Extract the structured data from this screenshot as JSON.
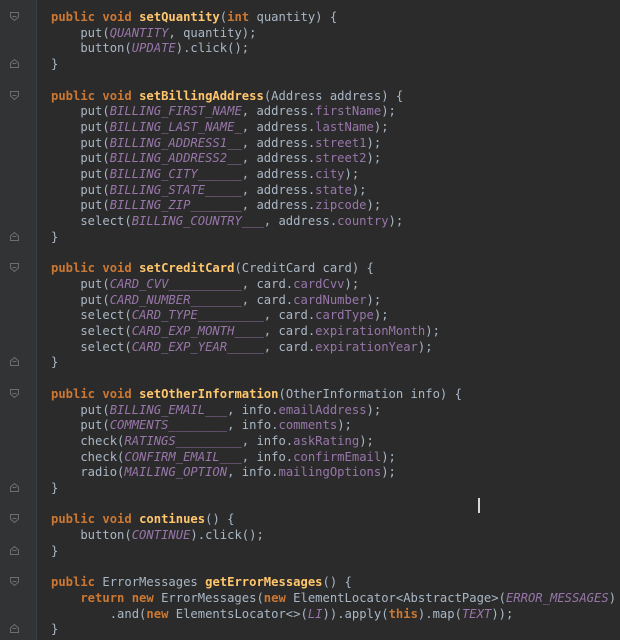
{
  "editor": {
    "theme": {
      "background": "#2b2b2b",
      "keyword": "#cc7832",
      "method": "#ffc66d",
      "constant": "#9876aa",
      "text": "#a9b7c6"
    },
    "lines": [
      {
        "fold": "start",
        "tokens": [
          [
            "kw",
            "public "
          ],
          [
            "kw",
            "void "
          ],
          [
            "fn",
            "setQuantity"
          ],
          [
            "pl",
            "("
          ],
          [
            "kw",
            "int "
          ],
          [
            "pl",
            "quantity) {"
          ]
        ]
      },
      {
        "fold": "",
        "tokens": [
          [
            "pl",
            "    put("
          ],
          [
            "cn",
            "QUANTITY"
          ],
          [
            "pl",
            ", quantity);"
          ]
        ]
      },
      {
        "fold": "",
        "tokens": [
          [
            "pl",
            "    button("
          ],
          [
            "cn",
            "UPDATE"
          ],
          [
            "pl",
            ").click();"
          ]
        ]
      },
      {
        "fold": "end",
        "tokens": [
          [
            "pl",
            "}"
          ]
        ]
      },
      {
        "fold": "",
        "tokens": []
      },
      {
        "fold": "start",
        "tokens": [
          [
            "kw",
            "public "
          ],
          [
            "kw",
            "void "
          ],
          [
            "fn",
            "setBillingAddress"
          ],
          [
            "pl",
            "(Address address) {"
          ]
        ]
      },
      {
        "fold": "",
        "tokens": [
          [
            "pl",
            "    put("
          ],
          [
            "cn",
            "BILLING_FIRST_NAME"
          ],
          [
            "pl",
            ", address."
          ],
          [
            "fd",
            "firstName"
          ],
          [
            "pl",
            ");"
          ]
        ]
      },
      {
        "fold": "",
        "tokens": [
          [
            "pl",
            "    put("
          ],
          [
            "cn",
            "BILLING_LAST_NAME_"
          ],
          [
            "pl",
            ", address."
          ],
          [
            "fd",
            "lastName"
          ],
          [
            "pl",
            ");"
          ]
        ]
      },
      {
        "fold": "",
        "tokens": [
          [
            "pl",
            "    put("
          ],
          [
            "cn",
            "BILLING_ADDRESS1__"
          ],
          [
            "pl",
            ", address."
          ],
          [
            "fd",
            "street1"
          ],
          [
            "pl",
            ");"
          ]
        ]
      },
      {
        "fold": "",
        "tokens": [
          [
            "pl",
            "    put("
          ],
          [
            "cn",
            "BILLING_ADDRESS2__"
          ],
          [
            "pl",
            ", address."
          ],
          [
            "fd",
            "street2"
          ],
          [
            "pl",
            ");"
          ]
        ]
      },
      {
        "fold": "",
        "tokens": [
          [
            "pl",
            "    put("
          ],
          [
            "cn",
            "BILLING_CITY______"
          ],
          [
            "pl",
            ", address."
          ],
          [
            "fd",
            "city"
          ],
          [
            "pl",
            ");"
          ]
        ]
      },
      {
        "fold": "",
        "tokens": [
          [
            "pl",
            "    put("
          ],
          [
            "cn",
            "BILLING_STATE_____"
          ],
          [
            "pl",
            ", address."
          ],
          [
            "fd",
            "state"
          ],
          [
            "pl",
            ");"
          ]
        ]
      },
      {
        "fold": "",
        "tokens": [
          [
            "pl",
            "    put("
          ],
          [
            "cn",
            "BILLING_ZIP_______"
          ],
          [
            "pl",
            ", address."
          ],
          [
            "fd",
            "zipcode"
          ],
          [
            "pl",
            ");"
          ]
        ]
      },
      {
        "fold": "",
        "tokens": [
          [
            "pl",
            "    select("
          ],
          [
            "cn",
            "BILLING_COUNTRY___"
          ],
          [
            "pl",
            ", address."
          ],
          [
            "fd",
            "country"
          ],
          [
            "pl",
            ");"
          ]
        ]
      },
      {
        "fold": "end",
        "tokens": [
          [
            "pl",
            "}"
          ]
        ]
      },
      {
        "fold": "",
        "tokens": []
      },
      {
        "fold": "start",
        "tokens": [
          [
            "kw",
            "public "
          ],
          [
            "kw",
            "void "
          ],
          [
            "fn",
            "setCreditCard"
          ],
          [
            "pl",
            "(CreditCard card) {"
          ]
        ]
      },
      {
        "fold": "",
        "tokens": [
          [
            "pl",
            "    put("
          ],
          [
            "cn",
            "CARD_CVV__________"
          ],
          [
            "pl",
            ", card."
          ],
          [
            "fd",
            "cardCvv"
          ],
          [
            "pl",
            ");"
          ]
        ]
      },
      {
        "fold": "",
        "tokens": [
          [
            "pl",
            "    put("
          ],
          [
            "cn",
            "CARD_NUMBER_______"
          ],
          [
            "pl",
            ", card."
          ],
          [
            "fd",
            "cardNumber"
          ],
          [
            "pl",
            ");"
          ]
        ]
      },
      {
        "fold": "",
        "tokens": [
          [
            "pl",
            "    select("
          ],
          [
            "cn",
            "CARD_TYPE_________"
          ],
          [
            "pl",
            ", card."
          ],
          [
            "fd",
            "cardType"
          ],
          [
            "pl",
            ");"
          ]
        ]
      },
      {
        "fold": "",
        "tokens": [
          [
            "pl",
            "    select("
          ],
          [
            "cn",
            "CARD_EXP_MONTH____"
          ],
          [
            "pl",
            ", card."
          ],
          [
            "fd",
            "expirationMonth"
          ],
          [
            "pl",
            ");"
          ]
        ]
      },
      {
        "fold": "",
        "tokens": [
          [
            "pl",
            "    select("
          ],
          [
            "cn",
            "CARD_EXP_YEAR_____"
          ],
          [
            "pl",
            ", card."
          ],
          [
            "fd",
            "expirationYear"
          ],
          [
            "pl",
            ");"
          ]
        ]
      },
      {
        "fold": "end",
        "tokens": [
          [
            "pl",
            "}"
          ]
        ]
      },
      {
        "fold": "",
        "tokens": []
      },
      {
        "fold": "start",
        "tokens": [
          [
            "kw",
            "public "
          ],
          [
            "kw",
            "void "
          ],
          [
            "fn",
            "setOtherInformation"
          ],
          [
            "pl",
            "(OtherInformation info) {"
          ]
        ]
      },
      {
        "fold": "",
        "tokens": [
          [
            "pl",
            "    put("
          ],
          [
            "cn",
            "BILLING_EMAIL___"
          ],
          [
            "pl",
            ", info."
          ],
          [
            "fd",
            "emailAddress"
          ],
          [
            "pl",
            ");"
          ]
        ]
      },
      {
        "fold": "",
        "tokens": [
          [
            "pl",
            "    put("
          ],
          [
            "cn",
            "COMMENTS________"
          ],
          [
            "pl",
            ", info."
          ],
          [
            "fd",
            "comments"
          ],
          [
            "pl",
            ");"
          ]
        ]
      },
      {
        "fold": "",
        "tokens": [
          [
            "pl",
            "    check("
          ],
          [
            "cn",
            "RATINGS_________"
          ],
          [
            "pl",
            ", info."
          ],
          [
            "fd",
            "askRating"
          ],
          [
            "pl",
            ");"
          ]
        ]
      },
      {
        "fold": "",
        "tokens": [
          [
            "pl",
            "    check("
          ],
          [
            "cn",
            "CONFIRM_EMAIL___"
          ],
          [
            "pl",
            ", info."
          ],
          [
            "fd",
            "confirmEmail"
          ],
          [
            "pl",
            ");"
          ]
        ]
      },
      {
        "fold": "",
        "tokens": [
          [
            "pl",
            "    radio("
          ],
          [
            "cn",
            "MAILING_OPTION"
          ],
          [
            "pl",
            ", info."
          ],
          [
            "fd",
            "mailingOptions"
          ],
          [
            "pl",
            ");"
          ]
        ]
      },
      {
        "fold": "end",
        "tokens": [
          [
            "pl",
            "}"
          ]
        ]
      },
      {
        "fold": "",
        "tokens": []
      },
      {
        "fold": "start",
        "tokens": [
          [
            "kw",
            "public "
          ],
          [
            "kw",
            "void "
          ],
          [
            "fn",
            "continues"
          ],
          [
            "pl",
            "() {"
          ]
        ]
      },
      {
        "fold": "",
        "tokens": [
          [
            "pl",
            "    button("
          ],
          [
            "cn",
            "CONTINUE"
          ],
          [
            "pl",
            ").click();"
          ]
        ]
      },
      {
        "fold": "end",
        "tokens": [
          [
            "pl",
            "}"
          ]
        ]
      },
      {
        "fold": "",
        "tokens": []
      },
      {
        "fold": "start",
        "tokens": [
          [
            "kw",
            "public "
          ],
          [
            "pl",
            "ErrorMessages "
          ],
          [
            "fn",
            "getErrorMessages"
          ],
          [
            "pl",
            "() {"
          ]
        ]
      },
      {
        "fold": "",
        "tokens": [
          [
            "kw",
            "    return new "
          ],
          [
            "pl",
            "ErrorMessages("
          ],
          [
            "kw",
            "new "
          ],
          [
            "pl",
            "ElementLocator<AbstractPage>("
          ],
          [
            "cn",
            "ERROR_MESSAGES"
          ],
          [
            "pl",
            ")"
          ]
        ]
      },
      {
        "fold": "",
        "tokens": [
          [
            "pl",
            "        .and("
          ],
          [
            "kw",
            "new "
          ],
          [
            "pl",
            "ElementsLocator<>("
          ],
          [
            "cn",
            "LI"
          ],
          [
            "pl",
            ")).apply("
          ],
          [
            "kw",
            "this"
          ],
          [
            "pl",
            ").map("
          ],
          [
            "cn",
            "TEXT"
          ],
          [
            "pl",
            "));"
          ]
        ]
      },
      {
        "fold": "end",
        "tokens": [
          [
            "pl",
            "}"
          ]
        ]
      }
    ]
  }
}
